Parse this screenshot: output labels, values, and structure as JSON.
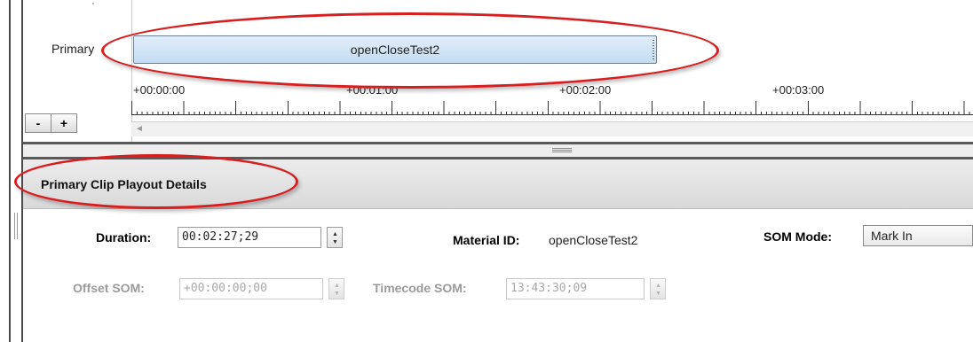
{
  "timeline": {
    "track_label": "Primary",
    "small_mark": "'",
    "clip_name": "openCloseTest2",
    "ruler_labels": [
      "+00:00:00",
      "+00:01:00",
      "+00:02:00",
      "+00:03:00"
    ],
    "zoom_out_label": "-",
    "zoom_in_label": "+",
    "scroll_left_arrow": "◄"
  },
  "panel": {
    "title": "Primary Clip Playout Details"
  },
  "details": {
    "duration_label": "Duration:",
    "duration_value": "00:02:27;29",
    "material_id_label": "Material ID:",
    "material_id_value": "openCloseTest2",
    "som_mode_label": "SOM Mode:",
    "som_mode_value": "Mark In",
    "offset_som_label": "Offset SOM:",
    "offset_som_value": "+00:00:00;00",
    "timecode_som_label": "Timecode SOM:",
    "timecode_som_value": "13:43:30;09"
  },
  "spinner": {
    "up": "▲",
    "down": "▼"
  },
  "colors": {
    "highlight": "#d81e1e",
    "clip_fill": "#c4dcf2",
    "panel_header": "#e0e0e0",
    "disabled_text": "#9a9a9a"
  },
  "icons": {
    "splitter": "splitter-grip-icon",
    "spinner_up": "arrow-up-icon",
    "spinner_down": "arrow-down-icon",
    "scroll_left": "arrow-left-icon"
  }
}
